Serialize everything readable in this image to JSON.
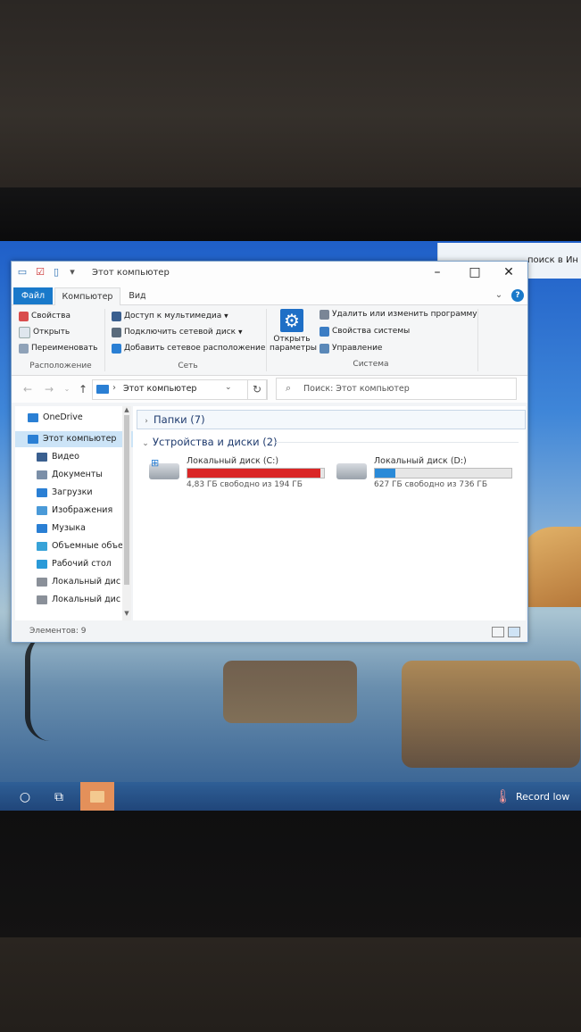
{
  "background_window": {
    "text": "поиск в Ин"
  },
  "window": {
    "title": "Этот компьютер",
    "tabs": {
      "file": "Файл",
      "computer": "Компьютер",
      "view": "Вид"
    },
    "ribbon": {
      "location": {
        "properties": "Свойства",
        "open": "Открыть",
        "rename": "Переименовать",
        "label": "Расположение"
      },
      "network": {
        "media_access": "Доступ к мультимедиа",
        "map_drive": "Подключить сетевой диск",
        "add_location": "Добавить сетевое расположение",
        "label": "Сеть"
      },
      "open_settings": {
        "line1": "Открыть",
        "line2": "параметры"
      },
      "system": {
        "uninstall": "Удалить или изменить программу",
        "system_properties": "Свойства системы",
        "manage": "Управление",
        "label": "Система"
      }
    },
    "address": {
      "path": "Этот компьютер"
    },
    "search": {
      "placeholder": "Поиск: Этот компьютер"
    },
    "nav_items": [
      {
        "label": "OneDrive",
        "icon": "cloud-icon",
        "color": "#2a7fd4"
      },
      {
        "label": "Этот компьютер",
        "icon": "computer-icon",
        "color": "#2a7fd4"
      },
      {
        "label": "Видео",
        "icon": "video-icon",
        "color": "#3a5f8f"
      },
      {
        "label": "Документы",
        "icon": "document-icon",
        "color": "#7b8fa8"
      },
      {
        "label": "Загрузки",
        "icon": "download-icon",
        "color": "#2a7fd4"
      },
      {
        "label": "Изображения",
        "icon": "pictures-icon",
        "color": "#4a9ad8"
      },
      {
        "label": "Музыка",
        "icon": "music-icon",
        "color": "#2a7fd4"
      },
      {
        "label": "Объемные объе",
        "icon": "3d-objects-icon",
        "color": "#38a3d8"
      },
      {
        "label": "Рабочий стол",
        "icon": "desktop-icon",
        "color": "#2a9ad8"
      },
      {
        "label": "Локальный дис",
        "icon": "drive-icon",
        "color": "#8a9099"
      },
      {
        "label": "Локальный дис",
        "icon": "drive-icon",
        "color": "#8a9099"
      }
    ],
    "sections": {
      "folders": "Папки (7)",
      "devices": "Устройства и диски (2)"
    },
    "drives": [
      {
        "name": "Локальный диск (C:)",
        "free": "4,83 ГБ свободно из 194 ГБ",
        "used_fraction": 0.975,
        "bar_color": "#da2626"
      },
      {
        "name": "Локальный диск (D:)",
        "free": "627 ГБ свободно из 736 ГБ",
        "used_fraction": 0.15,
        "bar_color": "#2a8ad8"
      }
    ],
    "status": "Элементов: 9"
  },
  "taskbar": {
    "weather": "Record low"
  }
}
